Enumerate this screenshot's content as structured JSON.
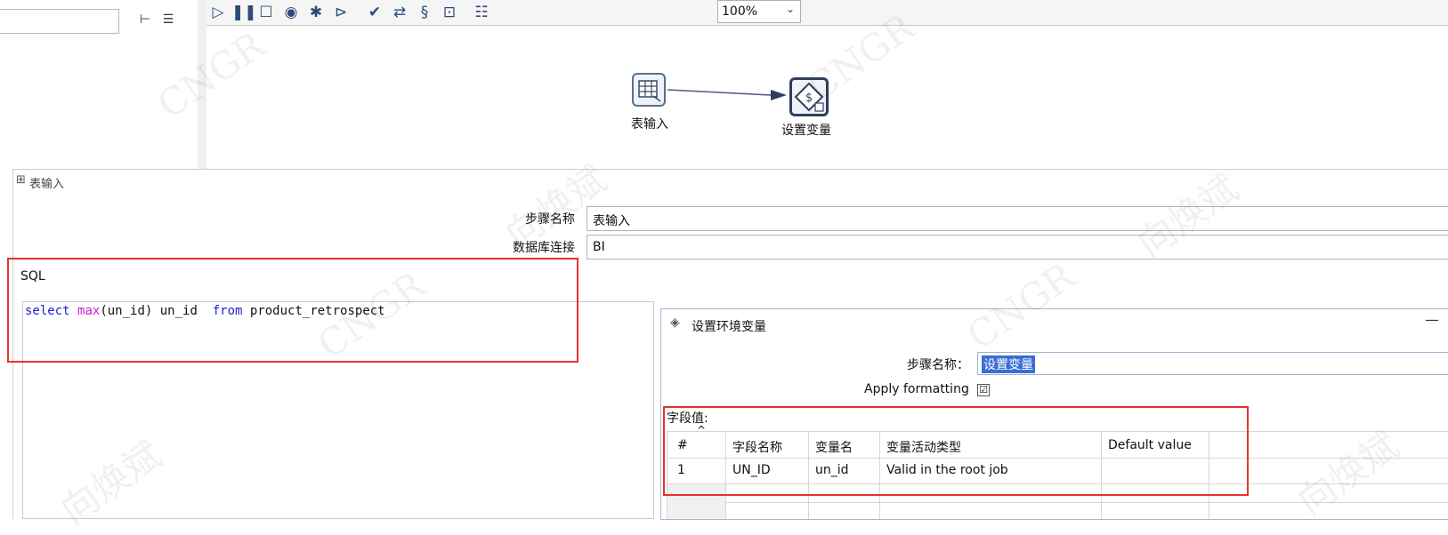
{
  "toolbar": {
    "icons": [
      "run-icon",
      "pause-icon",
      "stop-icon",
      "preview-icon",
      "debug-icon",
      "replay-icon",
      "verify-icon",
      "impact-icon",
      "sql-icon",
      "explore-db-icon",
      "show-results-icon"
    ],
    "zoom": "100%"
  },
  "canvas": {
    "step1_label": "表输入",
    "step2_label": "设置变量"
  },
  "table_input_dialog": {
    "title": "表输入",
    "step_name_label": "步骤名称",
    "step_name_value": "表输入",
    "db_conn_label": "数据库连接",
    "db_conn_value": "BI",
    "sql_label": "SQL",
    "sql_tokens": {
      "select": "select",
      "max": "max",
      "args": "(un_id) un_id  ",
      "from": "from",
      "table": " product_retrospect"
    }
  },
  "set_vars_dialog": {
    "title": "设置环境变量",
    "minimize": "—",
    "step_name_label": "步骤名称：",
    "step_name_value": "设置变量",
    "apply_formatting_label": "Apply formatting",
    "apply_formatting_checked": "☑",
    "fields_label": "字段值:",
    "columns": [
      "#",
      "字段名称",
      "变量名",
      "变量活动类型",
      "Default value"
    ],
    "rows": [
      [
        "1",
        "UN_ID",
        "un_id",
        "Valid in the root job",
        ""
      ]
    ]
  },
  "watermark": [
    "CNGR",
    "向焕斌"
  ],
  "colors": {
    "highlight_box": "#e8322e",
    "keyword": "#1f1fd6",
    "function": "#d01ad0",
    "selection": "#3a6fd1"
  }
}
